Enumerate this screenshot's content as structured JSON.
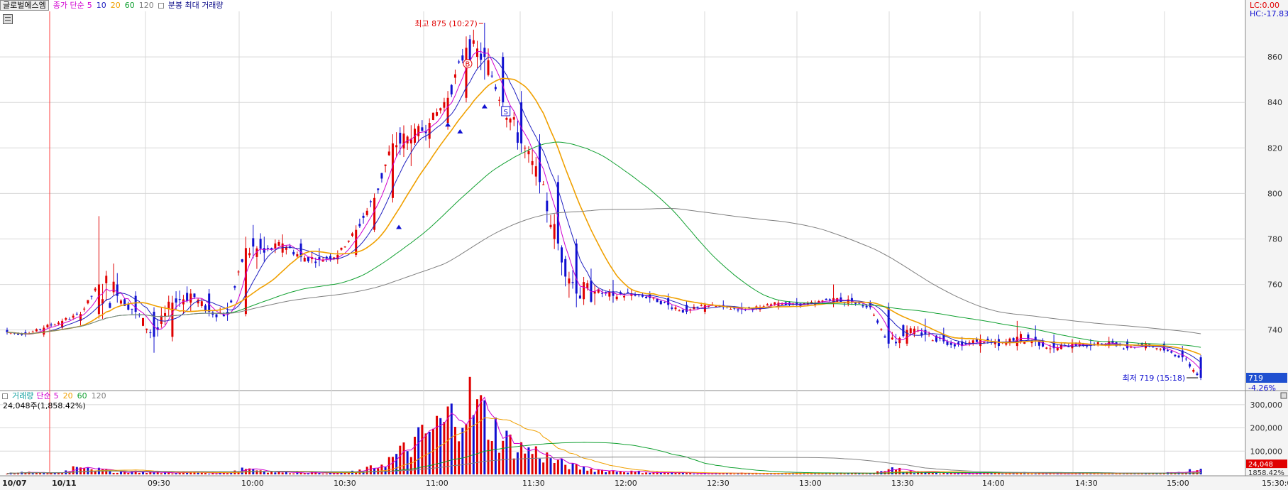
{
  "legend": {
    "ticker": "글로벌에스엠",
    "price_label": "종가 단순",
    "ma": [
      "5",
      "10",
      "20",
      "60",
      "120"
    ],
    "extra": "분봉 최대 거래량"
  },
  "volume_legend": {
    "label": "거래량",
    "ma_label": "단순",
    "ma": [
      "5",
      "20",
      "60",
      "120"
    ],
    "info": "24,048주(1,858.42%)"
  },
  "right_header": {
    "lc": "LC:0.00",
    "hc": "HC:-17.83"
  },
  "annotations": {
    "high": "최고 875 (10:27)",
    "low": "최저 719 (15:18)",
    "buy_marker": "B",
    "sell_marker": "S"
  },
  "current_price": {
    "value": "719",
    "change": "-4.26%"
  },
  "current_volume": {
    "value": "24,048",
    "pct": "1858.42%"
  },
  "colors": {
    "up": "#e00000",
    "down": "#1010d0",
    "ma5": "#d000d0",
    "ma10": "#2020c0",
    "ma20": "#f0a000",
    "ma60": "#10a030",
    "ma120": "#808080",
    "grid": "#d8d8d8",
    "axis_bg": "#f4f4f4"
  },
  "chart_data": {
    "type": "candlestick",
    "price_axis": {
      "ticks": [
        "860",
        "840",
        "820",
        "800",
        "780",
        "760",
        "740"
      ],
      "range": [
        714,
        880
      ]
    },
    "volume_axis": {
      "ticks": [
        "300,000",
        "200,000",
        "100,000"
      ],
      "range": [
        0,
        330000
      ]
    },
    "time_axis": [
      "10/07",
      "10/11",
      "09:30",
      "10:00",
      "10:30",
      "11:00",
      "11:30",
      "12:00",
      "12:30",
      "13:00",
      "13:30",
      "14:00",
      "14:30",
      "15:00",
      "15:30:00"
    ],
    "ohlc_minutes": [
      [
        0,
        740,
        741,
        738,
        739
      ],
      [
        15,
        739,
        740,
        737,
        738
      ],
      [
        30,
        738,
        742,
        737,
        741
      ],
      [
        45,
        741,
        745,
        740,
        744
      ],
      [
        60,
        744,
        748,
        742,
        747
      ],
      [
        75,
        747,
        790,
        745,
        760
      ],
      [
        90,
        760,
        765,
        752,
        755
      ],
      [
        105,
        755,
        757,
        745,
        748
      ],
      [
        120,
        748,
        750,
        730,
        737
      ],
      [
        135,
        737,
        755,
        735,
        752
      ],
      [
        150,
        752,
        758,
        748,
        756
      ],
      [
        165,
        756,
        758,
        746,
        748
      ],
      [
        180,
        748,
        752,
        744,
        747
      ],
      [
        195,
        747,
        781,
        746,
        776
      ],
      [
        210,
        776,
        781,
        770,
        774
      ],
      [
        225,
        774,
        782,
        772,
        778
      ],
      [
        240,
        778,
        780,
        770,
        772
      ],
      [
        255,
        772,
        776,
        768,
        771
      ],
      [
        270,
        771,
        775,
        769,
        773
      ],
      [
        285,
        773,
        786,
        772,
        784
      ],
      [
        300,
        784,
        800,
        783,
        798
      ],
      [
        315,
        798,
        826,
        796,
        822
      ],
      [
        330,
        822,
        830,
        812,
        824
      ],
      [
        345,
        824,
        833,
        820,
        831
      ],
      [
        360,
        831,
        845,
        828,
        842
      ],
      [
        375,
        842,
        869,
        840,
        864
      ],
      [
        390,
        864,
        875,
        850,
        860
      ],
      [
        405,
        860,
        862,
        835,
        840
      ],
      [
        420,
        840,
        845,
        818,
        822
      ],
      [
        435,
        822,
        826,
        800,
        805
      ],
      [
        450,
        805,
        808,
        775,
        778
      ],
      [
        465,
        778,
        780,
        750,
        756
      ],
      [
        480,
        756,
        760,
        751,
        757
      ],
      [
        495,
        757,
        762,
        752,
        755
      ],
      [
        510,
        755,
        758,
        753,
        756
      ],
      [
        525,
        756,
        757,
        752,
        754
      ],
      [
        540,
        754,
        756,
        749,
        751
      ],
      [
        555,
        751,
        753,
        747,
        748
      ],
      [
        570,
        748,
        752,
        747,
        751
      ],
      [
        585,
        751,
        753,
        749,
        750
      ],
      [
        600,
        750,
        752,
        747,
        749
      ],
      [
        615,
        749,
        751,
        748,
        750
      ],
      [
        630,
        750,
        753,
        749,
        752
      ],
      [
        645,
        752,
        754,
        750,
        751
      ],
      [
        660,
        751,
        753,
        750,
        752
      ],
      [
        675,
        752,
        760,
        750,
        754
      ],
      [
        690,
        754,
        756,
        751,
        752
      ],
      [
        705,
        752,
        753,
        749,
        750
      ],
      [
        720,
        750,
        752,
        732,
        734
      ],
      [
        735,
        734,
        742,
        733,
        740
      ],
      [
        750,
        740,
        745,
        735,
        738
      ],
      [
        765,
        738,
        741,
        734,
        735
      ],
      [
        780,
        735,
        737,
        731,
        733
      ],
      [
        795,
        733,
        738,
        730,
        736
      ],
      [
        810,
        736,
        738,
        731,
        733
      ],
      [
        825,
        733,
        744,
        731,
        737
      ],
      [
        840,
        737,
        742,
        733,
        735
      ],
      [
        855,
        735,
        738,
        730,
        732
      ],
      [
        870,
        732,
        736,
        730,
        734
      ],
      [
        885,
        734,
        736,
        731,
        733
      ],
      [
        900,
        733,
        737,
        732,
        735
      ],
      [
        915,
        735,
        736,
        731,
        732
      ],
      [
        930,
        732,
        735,
        731,
        734
      ],
      [
        945,
        734,
        735,
        730,
        731
      ],
      [
        960,
        731,
        733,
        726,
        728
      ],
      [
        975,
        728,
        729,
        718,
        719
      ]
    ],
    "volume_minutes": [
      [
        0,
        5000
      ],
      [
        15,
        8000
      ],
      [
        30,
        6000
      ],
      [
        45,
        9000
      ],
      [
        60,
        45000
      ],
      [
        75,
        20000
      ],
      [
        90,
        10000
      ],
      [
        105,
        12000
      ],
      [
        120,
        8000
      ],
      [
        135,
        7000
      ],
      [
        150,
        9000
      ],
      [
        165,
        6000
      ],
      [
        180,
        8000
      ],
      [
        195,
        30000
      ],
      [
        210,
        15000
      ],
      [
        225,
        9000
      ],
      [
        240,
        8000
      ],
      [
        255,
        7000
      ],
      [
        270,
        6000
      ],
      [
        285,
        12000
      ],
      [
        300,
        30000
      ],
      [
        315,
        70000
      ],
      [
        330,
        120000
      ],
      [
        345,
        180000
      ],
      [
        360,
        230000
      ],
      [
        375,
        320000
      ],
      [
        390,
        250000
      ],
      [
        405,
        150000
      ],
      [
        420,
        110000
      ],
      [
        435,
        90000
      ],
      [
        450,
        50000
      ],
      [
        465,
        30000
      ],
      [
        480,
        20000
      ],
      [
        495,
        15000
      ],
      [
        510,
        12000
      ],
      [
        525,
        9000
      ],
      [
        540,
        7000
      ],
      [
        555,
        6000
      ],
      [
        570,
        5000
      ],
      [
        585,
        5000
      ],
      [
        600,
        5000
      ],
      [
        615,
        4000
      ],
      [
        630,
        4000
      ],
      [
        645,
        4000
      ],
      [
        660,
        4000
      ],
      [
        675,
        6000
      ],
      [
        690,
        5000
      ],
      [
        705,
        4000
      ],
      [
        720,
        30000
      ],
      [
        735,
        12000
      ],
      [
        750,
        8000
      ],
      [
        765,
        6000
      ],
      [
        780,
        5000
      ],
      [
        795,
        5000
      ],
      [
        810,
        5000
      ],
      [
        825,
        8000
      ],
      [
        840,
        5000
      ],
      [
        855,
        4000
      ],
      [
        870,
        4000
      ],
      [
        885,
        4000
      ],
      [
        900,
        4000
      ],
      [
        915,
        4000
      ],
      [
        930,
        4000
      ],
      [
        945,
        5000
      ],
      [
        960,
        12000
      ],
      [
        975,
        24048
      ]
    ]
  }
}
